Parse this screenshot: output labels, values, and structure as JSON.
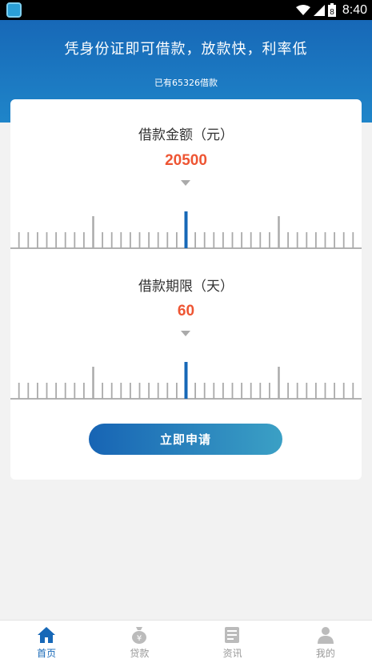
{
  "status_bar": {
    "time": "8:40",
    "battery": "8"
  },
  "header": {
    "slogan": "凭身份证即可借款，放款快，利率低",
    "borrow_count": "已有65326借款"
  },
  "amount": {
    "title": "借款金额（元）",
    "value": "20500"
  },
  "term": {
    "title": "借款期限（天）",
    "value": "60"
  },
  "apply_button": "立即申请",
  "tabs": [
    {
      "label": "首页",
      "icon": "home-icon",
      "active": true
    },
    {
      "label": "贷款",
      "icon": "money-bag-icon",
      "active": false
    },
    {
      "label": "资讯",
      "icon": "news-icon",
      "active": false
    },
    {
      "label": "我的",
      "icon": "user-icon",
      "active": false
    }
  ],
  "colors": {
    "primary": "#1768b7",
    "value": "#ee5533",
    "tab_inactive": "#999999"
  }
}
